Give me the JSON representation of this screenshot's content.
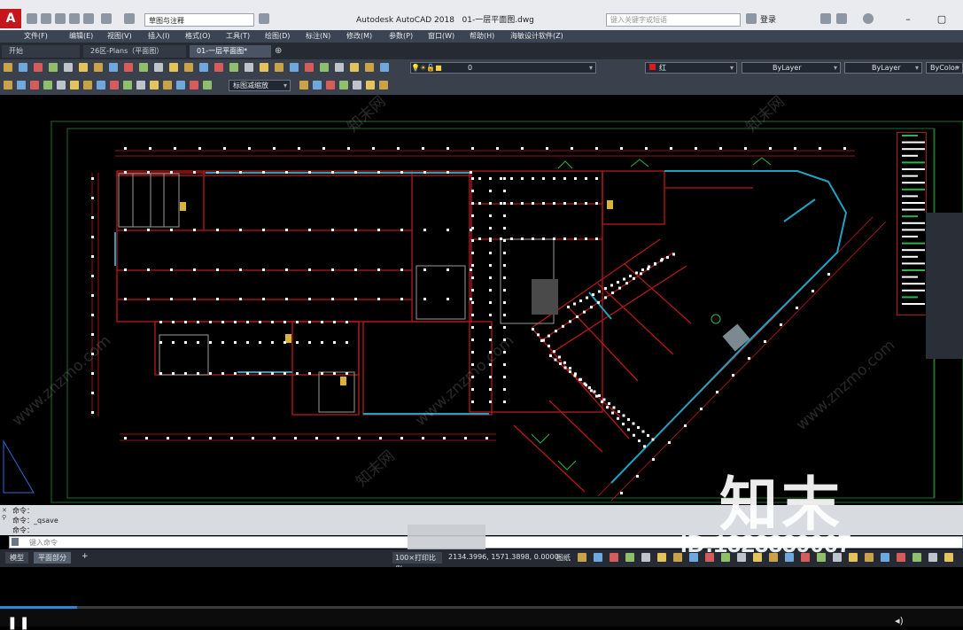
{
  "app": {
    "title": "Autodesk AutoCAD 2018",
    "filename": "01-一层平面图.dwg",
    "workspace": "草图与注释",
    "search_placeholder": "键入关键字或短语",
    "login": "登录",
    "logo_letter": "A"
  },
  "menu": [
    "文件(F)",
    "编辑(E)",
    "视图(V)",
    "插入(I)",
    "格式(O)",
    "工具(T)",
    "绘图(D)",
    "标注(N)",
    "修改(M)",
    "参数(P)",
    "窗口(W)",
    "帮助(H)",
    "海敏设计软件(Z)"
  ],
  "file_tabs": [
    {
      "label": "开始",
      "active": false
    },
    {
      "label": "26区-Plans（平面图）",
      "active": false
    },
    {
      "label": "01-一层平面图*",
      "active": true
    }
  ],
  "properties_bar": {
    "layer_value": "0",
    "color_value": "红",
    "linetype_value": "ByLayer",
    "lineweight_value": "ByLayer",
    "plotstyle_value": "ByColor",
    "zoom_combo": "标图减缩放"
  },
  "command": {
    "history": [
      "命令：",
      "命令：_qsave",
      "命令："
    ],
    "input_placeholder": "键入命令"
  },
  "status": {
    "layout_tabs": [
      {
        "label": "模型",
        "active": false
      },
      {
        "label": "平面部分",
        "active": true
      }
    ],
    "add_tab": "+",
    "scale": "100×打印比例",
    "coordinates": "2134.3996, 1571.3898, 0.0000",
    "model_label": "图纸"
  },
  "player": {
    "progress": 0.08,
    "pause_glyph": "❚❚"
  },
  "overlay": {
    "brand": "知末",
    "id": "ID:1323339067",
    "watermark_cn": "知末网",
    "watermark_url": "www.znzmo.com"
  },
  "colors": {
    "wall": "#c01a1a",
    "glass": "#1fa3c2",
    "border": "#1c6e2a",
    "dot": "#ffffff",
    "accent": "#c4161c"
  }
}
